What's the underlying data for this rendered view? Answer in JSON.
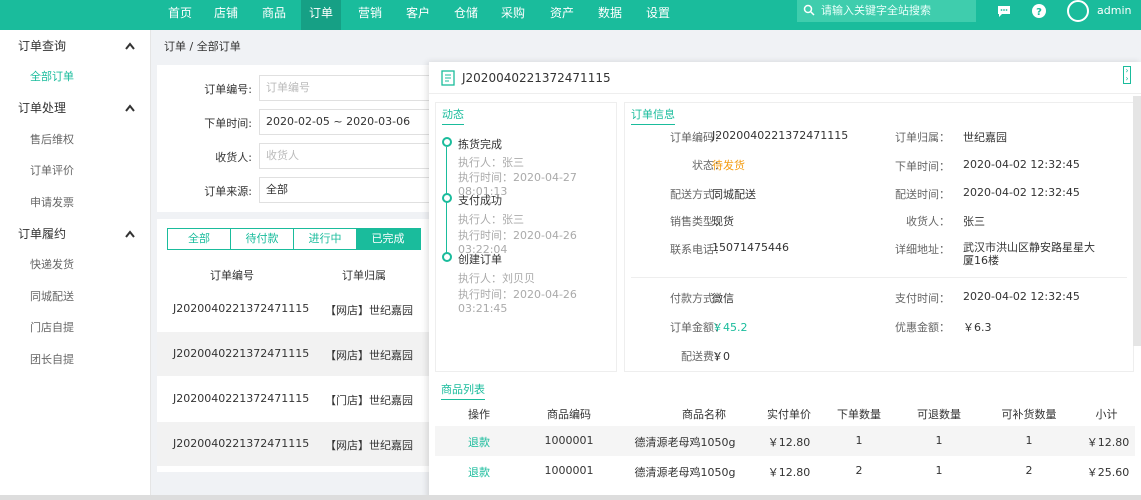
{
  "topnav": {
    "items": [
      "首页",
      "店铺",
      "商品",
      "订单",
      "营销",
      "客户",
      "仓储",
      "采购",
      "资产",
      "数据",
      "设置"
    ],
    "search_placeholder": "请输入关键字全站搜索",
    "user": "admin"
  },
  "sidebar": {
    "groups": [
      {
        "label": "订单查询",
        "items": [
          "全部订单"
        ]
      },
      {
        "label": "订单处理",
        "items": [
          "售后维权",
          "订单评价",
          "申请发票"
        ]
      },
      {
        "label": "订单履约",
        "items": [
          "快递发货",
          "同城配送",
          "门店自提",
          "团长自提"
        ]
      }
    ]
  },
  "breadcrumb": "订单 / 全部订单",
  "filter": {
    "order_no_label": "订单编号:",
    "order_no_placeholder": "订单编号",
    "time_label": "下单时间:",
    "time_value": "2020-02-05 ~ 2020-03-06",
    "receiver_label": "收货人:",
    "receiver_placeholder": "收货人",
    "source_label": "订单来源:",
    "source_value": "全部"
  },
  "list": {
    "tabs": [
      "全部",
      "待付款",
      "进行中",
      "已完成"
    ],
    "headers": [
      "订单编号",
      "订单归属"
    ],
    "rows": [
      {
        "no": "J2020040221372471115",
        "owner": "【网店】世纪嘉园"
      },
      {
        "no": "J2020040221372471115",
        "owner": "【网店】世纪嘉园"
      },
      {
        "no": "J2020040221372471115",
        "owner": "【门店】世纪嘉园"
      },
      {
        "no": "J2020040221372471115",
        "owner": "【网店】世纪嘉园"
      }
    ]
  },
  "detail": {
    "title": "J2020040221372471115",
    "timeline_title": "动态",
    "timeline": [
      {
        "title": "拣货完成",
        "operator": "执行人：张三",
        "time": "执行时间：2020-04-27 08:01:13"
      },
      {
        "title": "支付成功",
        "operator": "执行人：张三",
        "time": "执行时间：2020-04-26 03:22:04"
      },
      {
        "title": "创建订单",
        "operator": "执行人：刘贝贝",
        "time": "执行时间：2020-04-26 03:21:45"
      }
    ],
    "info_title": "订单信息",
    "info_left": [
      {
        "label": "订单编码：",
        "value": "J2020040221372471115"
      },
      {
        "label": "状态：",
        "value": "待发货"
      },
      {
        "label": "配送方式：",
        "value": "同城配送"
      },
      {
        "label": "销售类型：",
        "value": "现货"
      },
      {
        "label": "联系电话：",
        "value": "15071475446"
      }
    ],
    "info_right": [
      {
        "label": "订单归属：",
        "value": "世纪嘉园"
      },
      {
        "label": "下单时间：",
        "value": "2020-04-02 12:32:45"
      },
      {
        "label": "配送时间：",
        "value": "2020-04-02 12:32:45"
      },
      {
        "label": "收货人：",
        "value": "张三"
      },
      {
        "label": "详细地址：",
        "value": "武汉市洪山区静安路星星大厦16楼"
      }
    ],
    "pay_left": [
      {
        "label": "付款方式：",
        "value": "微信"
      },
      {
        "label": "订单金额：",
        "value": "￥45.2"
      },
      {
        "label": "配送费：",
        "value": "￥0"
      }
    ],
    "pay_right": [
      {
        "label": "支付时间：",
        "value": "2020-04-02 12:32:45"
      },
      {
        "label": "优惠金额：",
        "value": "￥6.3"
      }
    ],
    "goods_title": "商品列表",
    "goods_headers": [
      "操作",
      "商品编码",
      "商品名称",
      "实付单价",
      "下单数量",
      "可退数量",
      "可补货数量",
      "小计"
    ],
    "goods_rows": [
      [
        "退款",
        "1000001",
        "德清源老母鸡1050g",
        "￥12.80",
        "1",
        "1",
        "1",
        "￥12.80"
      ],
      [
        "退款",
        "1000001",
        "德清源老母鸡1050g",
        "￥12.80",
        "2",
        "1",
        "2",
        "￥25.60"
      ]
    ]
  },
  "colors": {
    "accent": "#1abc9c",
    "status_orange": "#f39c12"
  }
}
